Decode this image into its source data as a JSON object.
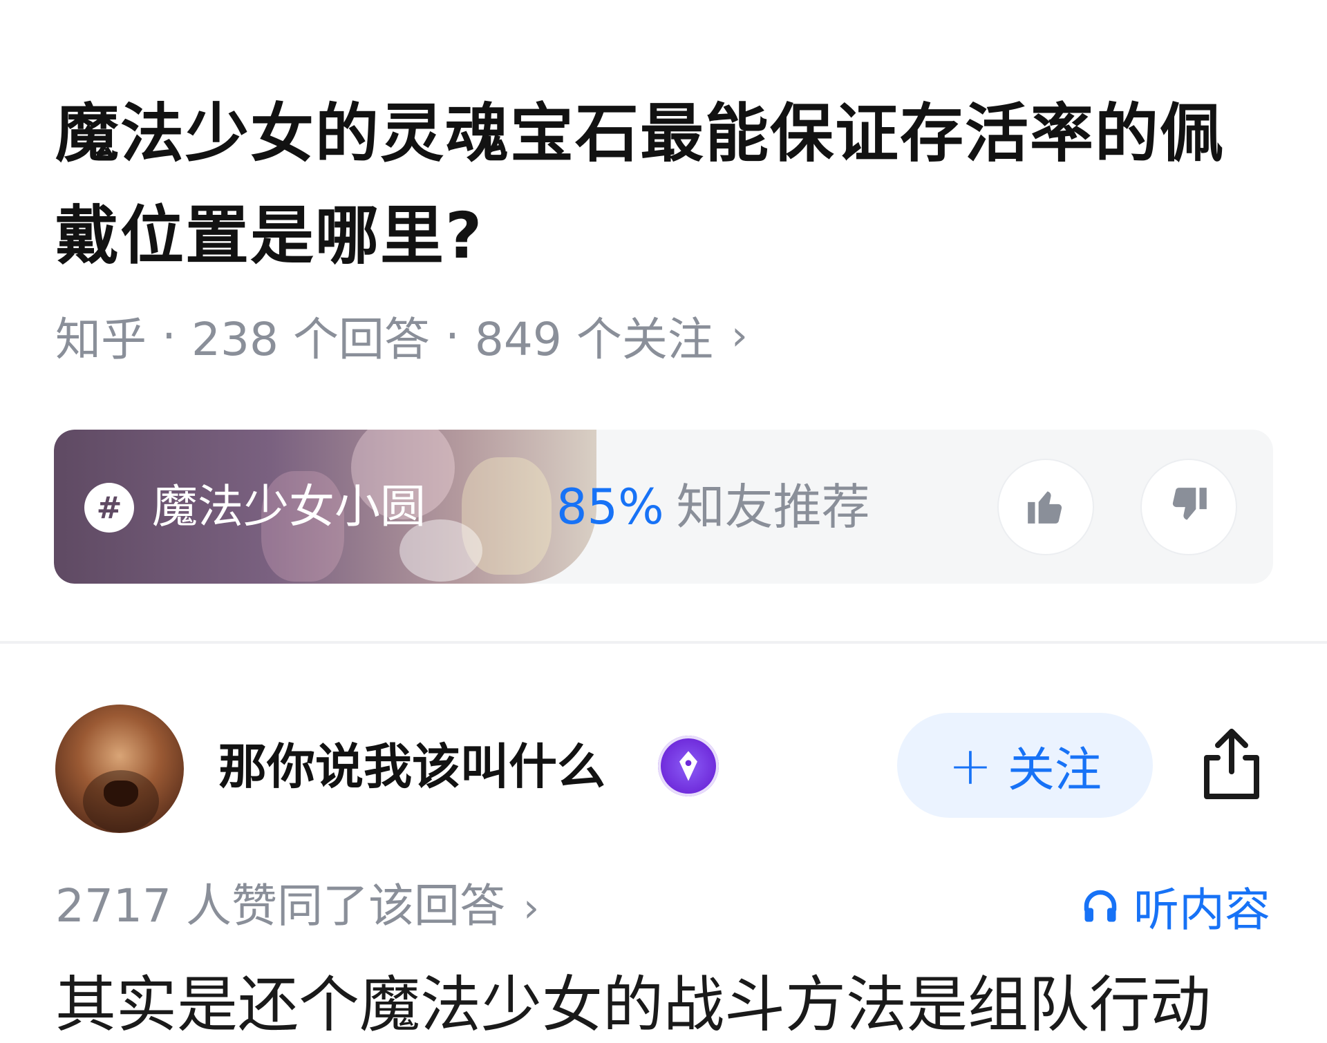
{
  "question": {
    "title": "魔法少女的灵魂宝石最能保证存活率的佩戴位置是哪里?",
    "source": "知乎",
    "answers": "238 个回答",
    "followers": "849 个关注",
    "separator": "·",
    "chevron": "›"
  },
  "circle": {
    "name": "魔法少女小圆",
    "hash_symbol": "#",
    "recommend_percent": "85%",
    "recommend_label": "知友推荐",
    "icons": [
      "hashtag-icon",
      "thumbs-up-icon",
      "thumbs-down-icon"
    ]
  },
  "answer": {
    "author_name": "那你说我该叫什么",
    "author_badge_icon": "pen-badge-icon",
    "follow_plus": "+",
    "follow_label": "关注",
    "share_icon": "share-icon",
    "upvotes_text": "2717 人赞同了该回答",
    "chevron": "›",
    "listen_label": "听内容",
    "listen_icon": "headphones-icon",
    "first_line": "其实是还个魔法少女的战斗方法是组队行动"
  },
  "colors": {
    "accent_blue": "#1772f6",
    "meta_gray": "#8a8f99",
    "follow_bg": "#ebf3ff",
    "card_bg": "#f5f6f7",
    "badge_purple": "#6d28d9"
  }
}
